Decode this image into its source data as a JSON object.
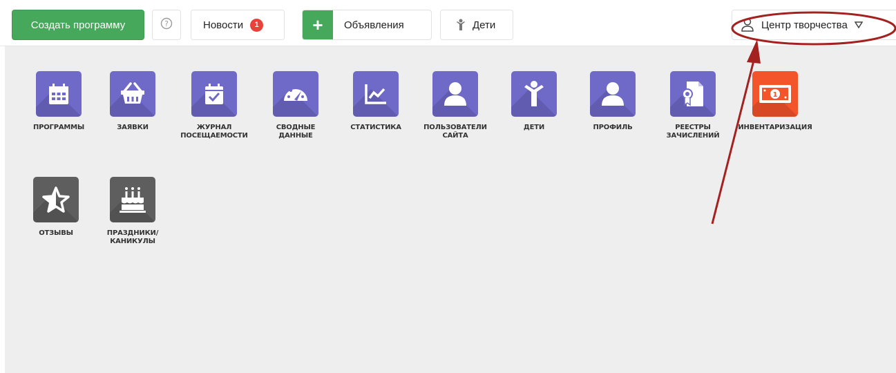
{
  "toolbar": {
    "create_label": "Создать программу",
    "news_label": "Новости",
    "news_count": "1",
    "ads_label": "Объявления",
    "kids_label": "Дети",
    "user_label": "Центр творчества"
  },
  "tiles": [
    {
      "label": "ПРОГРАММЫ",
      "icon": "calendar-icon",
      "color": "#6f69c8"
    },
    {
      "label": "ЗАЯВКИ",
      "icon": "basket-icon",
      "color": "#6f69c8"
    },
    {
      "label": "ЖУРНАЛ\nПОСЕЩАЕМОСТИ",
      "icon": "calendar-check-icon",
      "color": "#6f69c8"
    },
    {
      "label": "СВОДНЫЕ\nДАННЫЕ",
      "icon": "gauge-icon",
      "color": "#6f69c8"
    },
    {
      "label": "СТАТИСТИКА",
      "icon": "line-chart-icon",
      "color": "#6f69c8"
    },
    {
      "label": "ПОЛЬЗОВАТЕЛИ\nСАЙТА",
      "icon": "user-icon",
      "color": "#6f69c8"
    },
    {
      "label": "ДЕТИ",
      "icon": "child-icon",
      "color": "#6f69c8"
    },
    {
      "label": "ПРОФИЛЬ",
      "icon": "profile-icon",
      "color": "#6f69c8"
    },
    {
      "label": "РЕЕСТРЫ\nЗАЧИСЛЕНИЙ",
      "icon": "certificate-icon",
      "color": "#6f69c8"
    },
    {
      "label": "ИНВЕНТАРИЗАЦИЯ",
      "icon": "money-icon",
      "color": "#f4542a"
    },
    {
      "label": "ОТЗЫВЫ",
      "icon": "star-icon",
      "color": "#5e5e5e"
    },
    {
      "label": "ПРАЗДНИКИ/\nКАНИКУЛЫ",
      "icon": "cake-icon",
      "color": "#5e5e5e"
    }
  ]
}
